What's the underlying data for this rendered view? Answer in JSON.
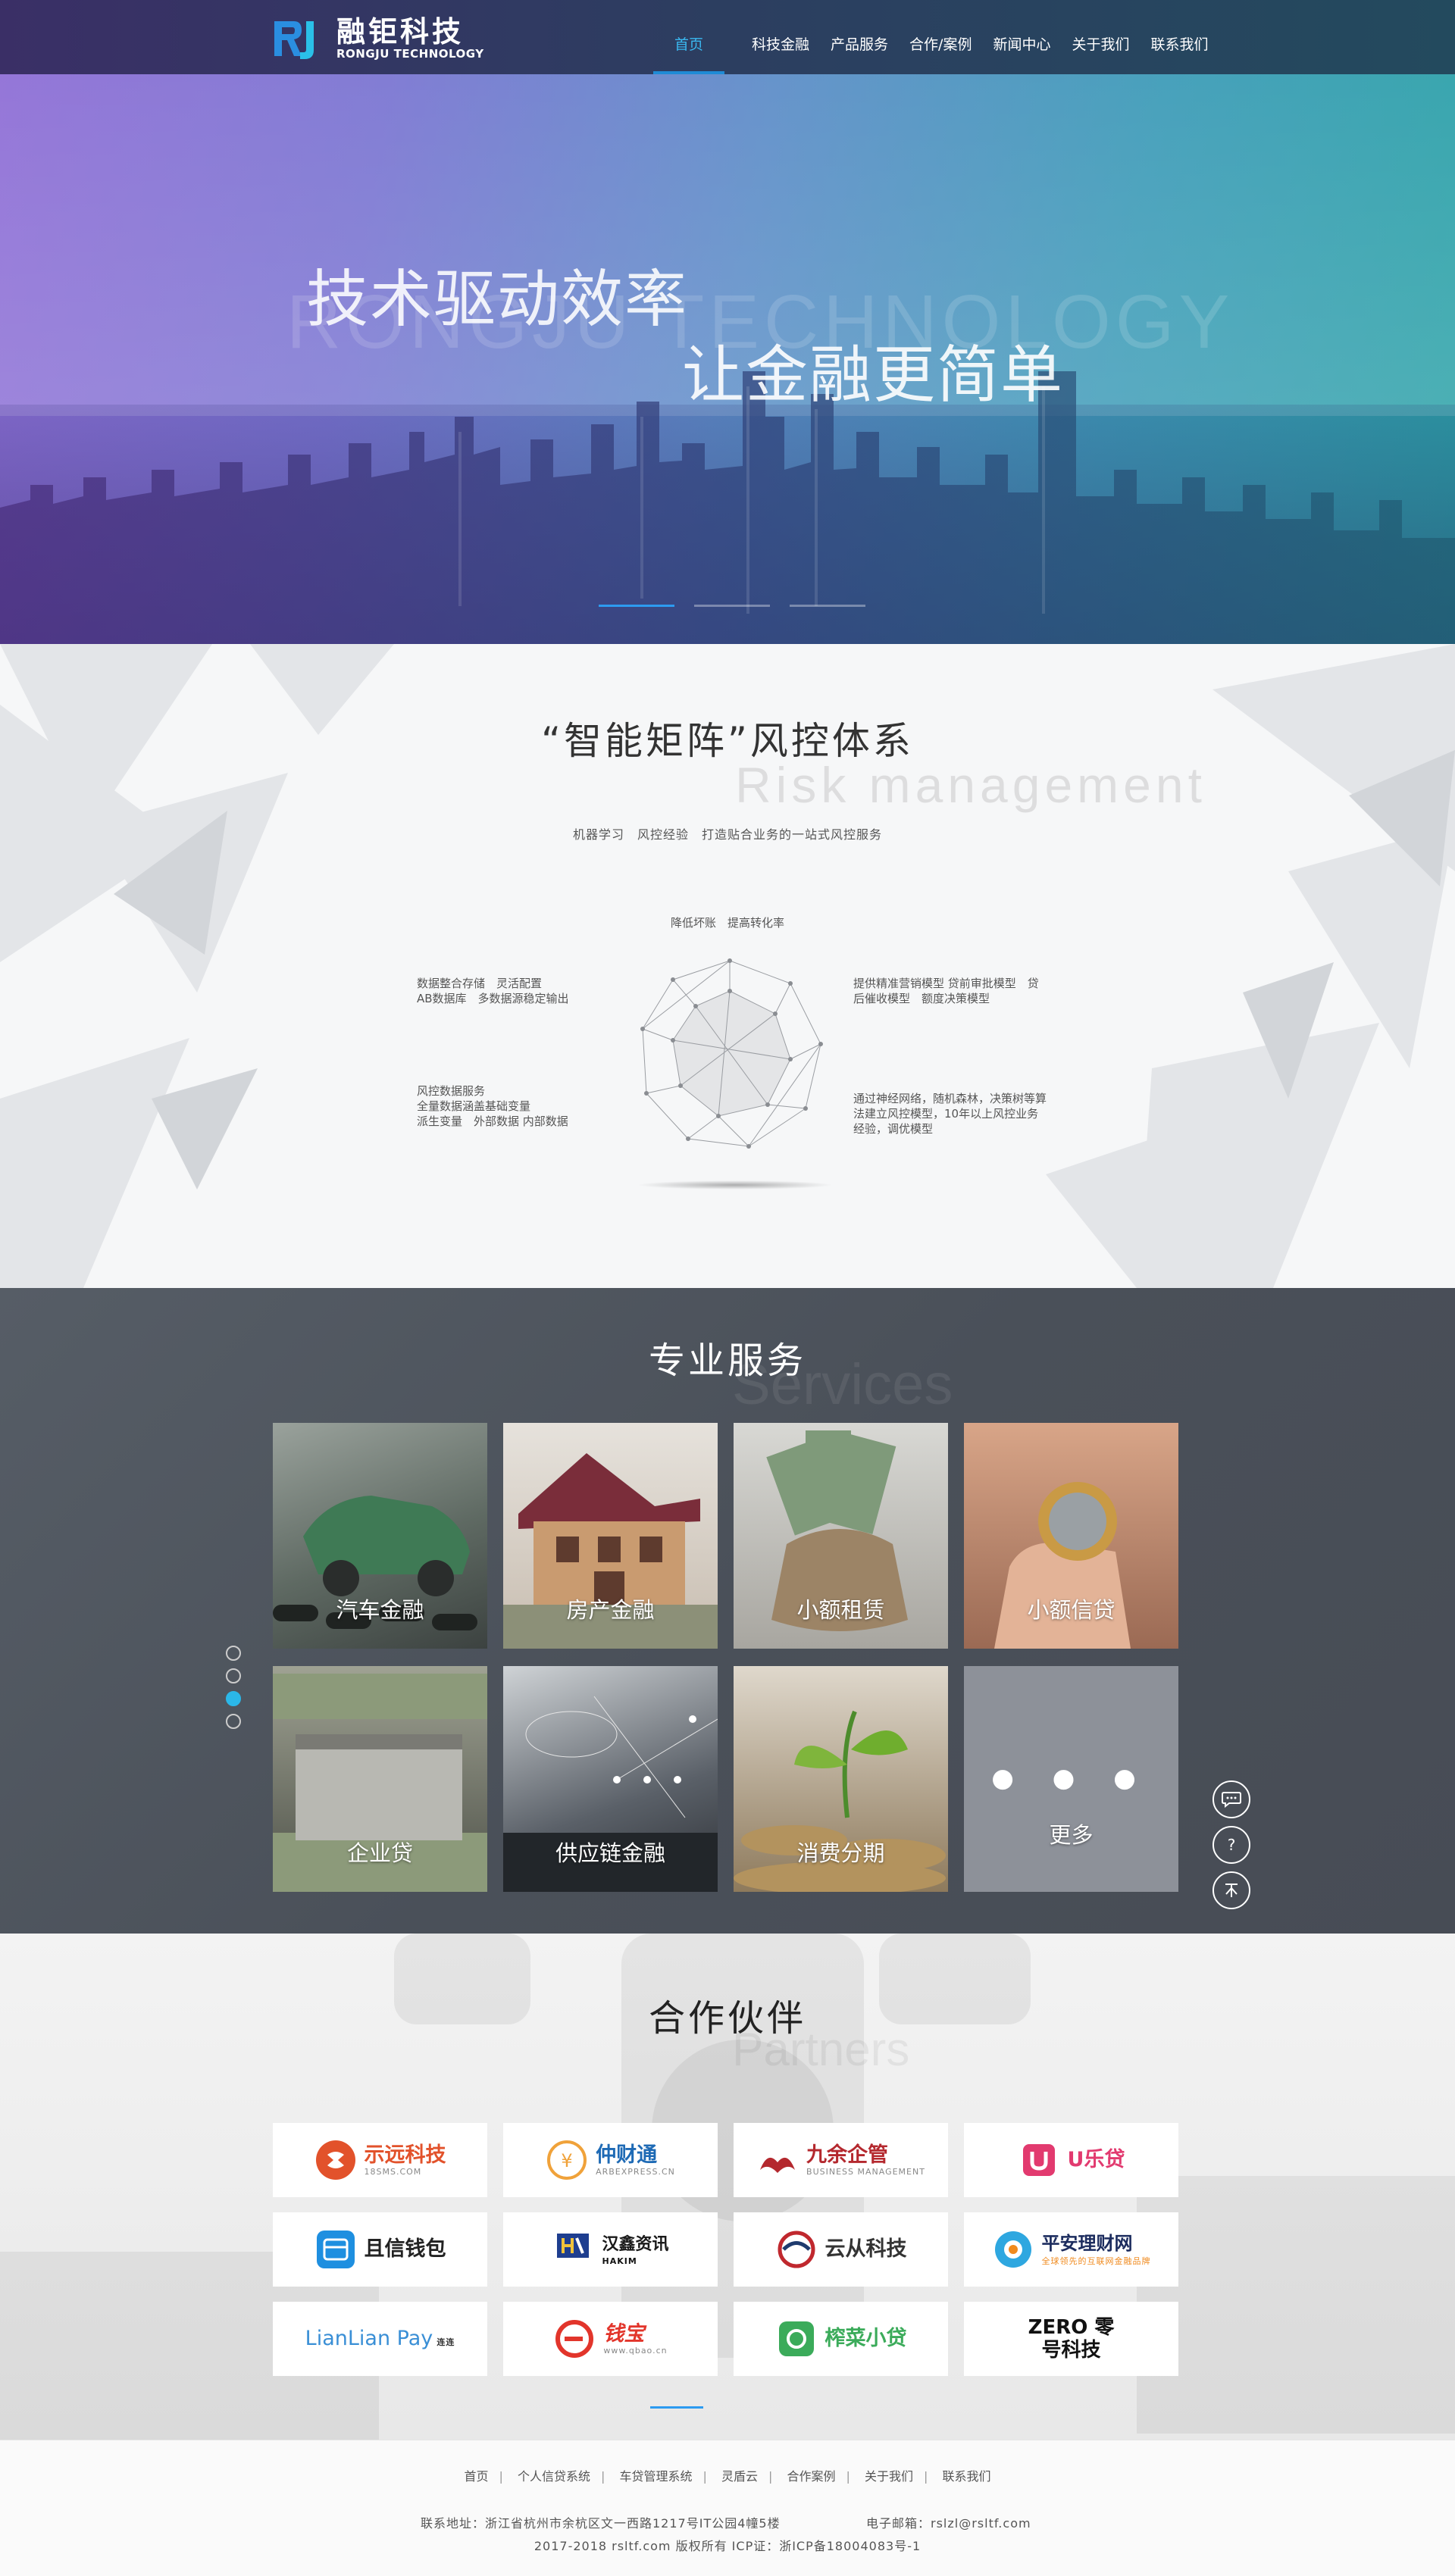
{
  "header": {
    "logo_cn": "融钜科技",
    "logo_en": "RONGJU TECHNOLOGY",
    "nav": [
      "首页",
      "科技金融",
      "产品服务",
      "合作/案例",
      "新闻中心",
      "关于我们",
      "联系我们"
    ],
    "active_nav": "首页"
  },
  "hero": {
    "line1": "技术驱动效率",
    "line2": "让金融更简单",
    "watermark": "RONGJU TECHNOLOGY",
    "slides": 3,
    "active_slide": 1
  },
  "risk": {
    "title": "“智能矩阵”风控体系",
    "watermark": "Risk management",
    "subtitle": "机器学习　风控经验　打造贴合业务的一站式风控服务",
    "top": "降低坏账　提高转化率",
    "left_top": "数据整合存储　灵活配置\nAB数据库　多数据源稳定输出",
    "left_bottom": "风控数据服务\n全量数据涵盖基础变量\n派生变量　外部数据 内部数据",
    "right_top": "提供精准营销模型 贷前审批模型　贷\n后催收模型　额度决策模型",
    "right_bottom": "通过神经网络，随机森林，决策树等算\n法建立风控模型，10年以上风控业务\n经验，调优模型"
  },
  "services": {
    "title": "专业服务",
    "watermark": "Services",
    "items": [
      "汽车金融",
      "房产金融",
      "小额租赁",
      "小额信贷",
      "企业贷",
      "供应链金融",
      "消费分期",
      "更多"
    ],
    "more_dots": "● ● ●",
    "pager_count": 4,
    "pager_active": 3
  },
  "partners": {
    "title": "合作伙伴",
    "watermark": "Partners",
    "items": [
      {
        "name": "示远科技",
        "sub": "18SMS.COM",
        "color": "#e2522b"
      },
      {
        "name": "仲财通",
        "sub": "ARBEXPRESS.CN",
        "color": "#1e6ab5"
      },
      {
        "name": "九余企管",
        "sub": "BUSINESS MANAGEMENT",
        "color": "#b4282e"
      },
      {
        "name": "U乐贷",
        "sub": "",
        "color": "#e23a6f"
      },
      {
        "name": "且信钱包",
        "sub": "",
        "color": "#222222"
      },
      {
        "name": "汉鑫资讯",
        "sub": "HAKIM",
        "color": "#1a1a1a"
      },
      {
        "name": "云从科技",
        "sub": "",
        "color": "#333333"
      },
      {
        "name": "平安理财网",
        "sub": "全球领先的互联网金融品牌",
        "color": "#1c2c5e"
      },
      {
        "name": "LianLian Pay",
        "sub": "连连",
        "color": "#3a8fd6"
      },
      {
        "name": "钱宝",
        "sub": "www.qbao.cn",
        "color": "#e2352b"
      },
      {
        "name": "榨菜小贷",
        "sub": "",
        "color": "#3bab5a"
      },
      {
        "name": "ZERO 零号科技",
        "sub": "",
        "color": "#111111"
      }
    ]
  },
  "footer": {
    "links": [
      "首页",
      "个人信贷系统",
      "车贷管理系统",
      "灵盾云",
      "合作案例",
      "关于我们",
      "联系我们"
    ],
    "address": "联系地址：浙江省杭州市余杭区文一西路1217号IT公园4幢5楼",
    "email": "电子邮箱：rslzl@rsltf.com",
    "copyright": "2017-2018 rsltf.com 版权所有 ICP证：浙ICP备18004083号-1"
  },
  "colors": {
    "accent": "#2d9bf0",
    "header_bg": "#2f3a5e",
    "services_bg": "#4f555e"
  }
}
